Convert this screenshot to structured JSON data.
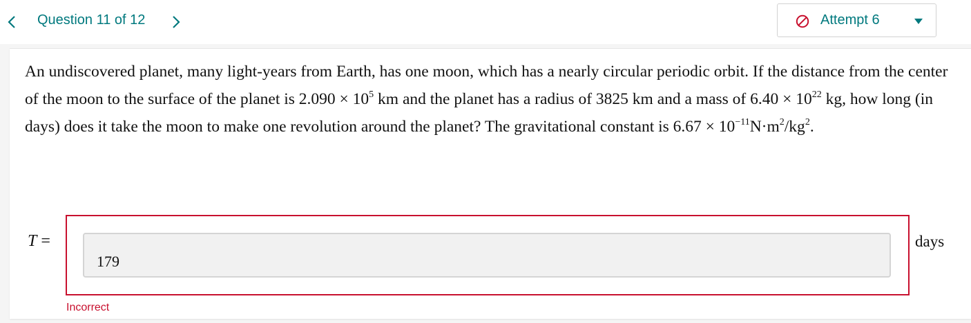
{
  "header": {
    "question_counter": "Question 11 of 12",
    "attempt_label": "Attempt 6",
    "icons": {
      "prev": "chevron-left-icon",
      "next": "chevron-right-icon",
      "attempt_status": "prohibited-circle-icon",
      "dropdown": "caret-down-icon"
    }
  },
  "question": {
    "sentence_1": "An undiscovered planet, many light-years from Earth, has one moon, which has a nearly circular periodic orbit. If the distance from the center of the moon to the surface of the planet is",
    "distance_mantissa": "2.090 × 10",
    "distance_exponent": "5",
    "distance_unit": "km",
    "radius_text": "and the planet has a radius of",
    "radius_value": "3825 km",
    "mass_text": "and a mass of",
    "mass_mantissa": "6.40 × 10",
    "mass_exponent": "22",
    "mass_unit": "kg",
    "ask_text": ", how long (in days) does it take the moon to make one revolution around the planet? The gravitational constant is",
    "g_mantissa": "6.67 × 10",
    "g_exponent": "−11",
    "g_unit_1": "N·m",
    "g_unit_exp_1": "2",
    "g_unit_2": "/kg",
    "g_unit_exp_2": "2",
    "end_punct": "."
  },
  "answer": {
    "variable": "T",
    "equals": "=",
    "value": "179",
    "unit": "days",
    "feedback": "Incorrect"
  },
  "colors": {
    "accent": "#00797e",
    "error": "#c8102e",
    "input_bg": "#f1f1f1"
  }
}
